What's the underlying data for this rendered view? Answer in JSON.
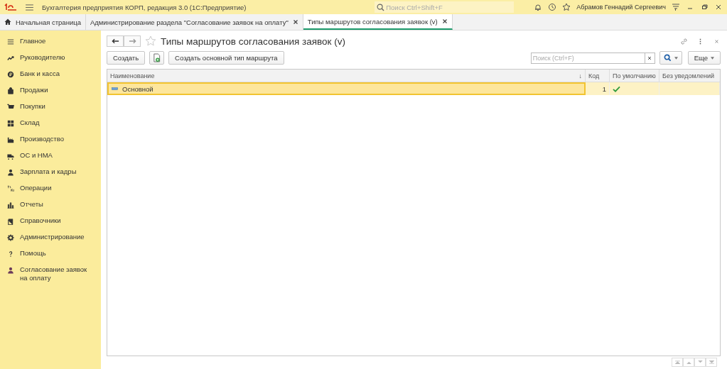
{
  "app": {
    "title": "Бухгалтерия предприятия КОРП, редакция 3.0  (1С:Предприятие)",
    "search_placeholder": "Поиск Ctrl+Shift+F",
    "user": "Абрамов Геннадий Сергеевич"
  },
  "tabs": [
    {
      "label": "Начальная страница",
      "selected": false,
      "closable": false
    },
    {
      "label": "Администрирование раздела \"Согласование заявок на оплату\"",
      "selected": false,
      "closable": true
    },
    {
      "label": "Типы маршрутов согласования заявок (v)",
      "selected": true,
      "closable": true
    }
  ],
  "sidebar": {
    "items": [
      {
        "label": "Главное"
      },
      {
        "label": "Руководителю"
      },
      {
        "label": "Банк и касса"
      },
      {
        "label": "Продажи"
      },
      {
        "label": "Покупки"
      },
      {
        "label": "Склад"
      },
      {
        "label": "Производство"
      },
      {
        "label": "ОС и НМА"
      },
      {
        "label": "Зарплата и кадры"
      },
      {
        "label": "Операции"
      },
      {
        "label": "Отчеты"
      },
      {
        "label": "Справочники"
      },
      {
        "label": "Администрирование"
      },
      {
        "label": "Помощь"
      },
      {
        "label": "Согласование заявок на оплату"
      }
    ]
  },
  "form": {
    "title": "Типы маршрутов согласования заявок (v)",
    "buttons": [
      {
        "label": "Создать"
      },
      {
        "label": "Создать основной тип маршрута"
      }
    ],
    "search_placeholder": "Поиск (Ctrl+F)",
    "more_button": "Еще",
    "table": {
      "columns": [
        {
          "label": "Наименование",
          "sort": "↓"
        },
        {
          "label": "Код"
        },
        {
          "label": "По умолчанию"
        },
        {
          "label": "Без уведомлений"
        }
      ],
      "rows": [
        {
          "name": "Основной",
          "code": "1",
          "default": true,
          "no_notifications": false,
          "selected": true
        }
      ]
    }
  }
}
